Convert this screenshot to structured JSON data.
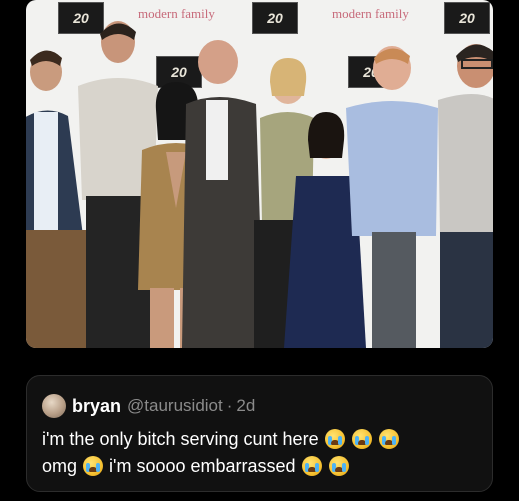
{
  "photo": {
    "logo_text": "20",
    "brand_text": "modern family"
  },
  "tweet": {
    "display_name": "bryan",
    "handle": "@taurusidiot",
    "separator": "·",
    "time_ago": "2d",
    "text_line1": "i'm the only bitch serving cunt here",
    "text_line2_a": "omg",
    "text_line2_b": "i'm soooo embarrassed",
    "emoji_icon": "loudly-crying-face-icon"
  }
}
